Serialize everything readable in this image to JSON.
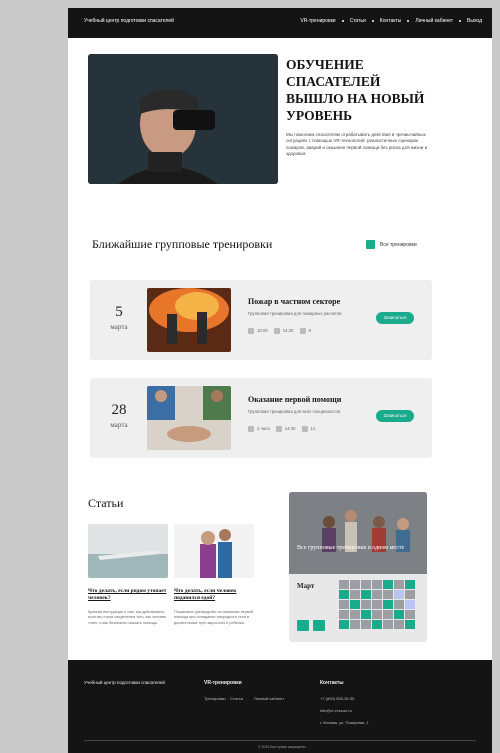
{
  "header": {
    "brand": "Учебный центр подготовки спасателей",
    "nav": [
      "VR-тренировки",
      "Статьи",
      "Контакты",
      "Личный кабинет",
      "Выход"
    ]
  },
  "hero": {
    "title": "Обучение спасателей вышло на новый уровень",
    "text": "Мы помогаем спасателям отрабатывать действия в чрезвычайных ситуациях с помощью VR-технологий: реалистичные сценарии пожаров, аварий и оказания первой помощи без риска для жизни и здоровья."
  },
  "events_section": {
    "title": "Ближайшие групповые тренировки",
    "all_link": "Все тренировки",
    "events": [
      {
        "day": "5",
        "month": "марта",
        "name": "Пожар в частном секторе",
        "sub": "Групповая тренировка для пожарных расчетов",
        "meta": [
          "10:00",
          "14:30",
          "8"
        ],
        "button": "Записаться"
      },
      {
        "day": "28",
        "month": "марта",
        "name": "Оказание первой помощи",
        "sub": "Групповая тренировка для всех специалистов",
        "meta": [
          "2 часа",
          "14:30",
          "12"
        ],
        "button": "Записаться"
      }
    ]
  },
  "articles_section": {
    "title": "Статьи",
    "articles": [
      {
        "title": "Что делать, если рядом утопает человек?",
        "text": "Краткая инструкция о том, как действовать, если вы стали свидетелем того, как человек тонет, и как безопасно оказать помощь."
      },
      {
        "title": "Что делать, если человек подавился едой?",
        "text": "Пошаговое руководство по оказанию первой помощи при попадании инородного тела в дыхательные пути взрослого и ребенка."
      }
    ]
  },
  "calendar": {
    "caption": "Все групповые тренировки в одном месте",
    "month": "Март"
  },
  "footer": {
    "brand": "Учебный центр подготовки спасателей",
    "col1_title": "VR-тренировки",
    "col1_items": [
      "Тренировки",
      "Статьи",
      "Личный кабинет"
    ],
    "col2_title": "Контакты",
    "col2_items": [
      "+7 (800) 555-35-35",
      "info@vr-rescue.ru",
      "г. Москва, ул. Пожарная, 1"
    ],
    "copyright": "© 2024 Все права защищены"
  }
}
